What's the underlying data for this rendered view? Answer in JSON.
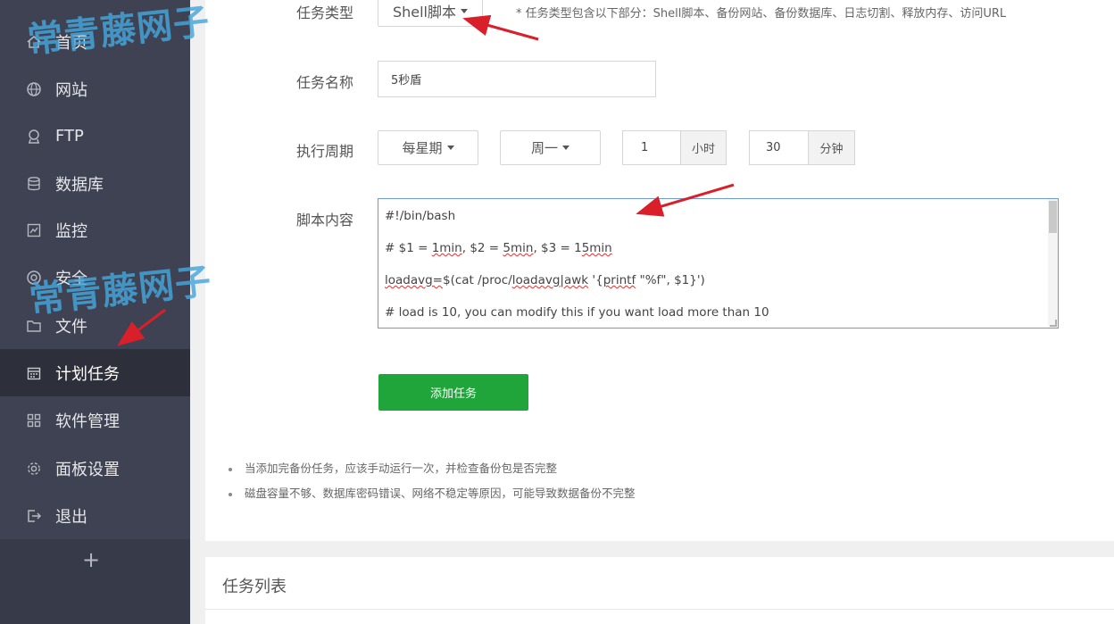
{
  "sidebar": {
    "items": [
      {
        "label": "首页",
        "icon": "home-icon"
      },
      {
        "label": "网站",
        "icon": "globe-icon"
      },
      {
        "label": "FTP",
        "icon": "ftp-icon"
      },
      {
        "label": "数据库",
        "icon": "database-icon"
      },
      {
        "label": "监控",
        "icon": "monitor-icon"
      },
      {
        "label": "安全",
        "icon": "shield-icon"
      },
      {
        "label": "文件",
        "icon": "folder-icon"
      },
      {
        "label": "计划任务",
        "icon": "calendar-icon"
      },
      {
        "label": "软件管理",
        "icon": "apps-icon"
      },
      {
        "label": "面板设置",
        "icon": "gear-icon"
      },
      {
        "label": "退出",
        "icon": "logout-icon"
      }
    ],
    "active": "计划任务",
    "add_symbol": "+"
  },
  "form": {
    "task_type": {
      "label": "任务类型",
      "value": "Shell脚本",
      "note": "*  任务类型包含以下部分：Shell脚本、备份网站、备份数据库、日志切割、释放内存、访问URL"
    },
    "task_name": {
      "label": "任务名称",
      "value": "5秒盾"
    },
    "schedule": {
      "label": "执行周期",
      "period": "每星期",
      "day": "周一",
      "hour": "1",
      "hour_unit": "小时",
      "minute": "30",
      "minute_unit": "分钟"
    },
    "script": {
      "label": "脚本内容",
      "lines": [
        "#!/bin/bash",
        "# $1 = 1min, $2 = 5min, $3 = 15min",
        "loadavg=$(cat /proc/loadavg|awk '{printf \"%f\", $1}')",
        "# load is 10, you can modify this if you want load more than 10"
      ]
    },
    "submit_label": "添加任务"
  },
  "tips": [
    "当添加完备份任务，应该手动运行一次，并检查备份包是否完整",
    "磁盘容量不够、数据库密码错误、网络不稳定等原因，可能导致数据备份不完整"
  ],
  "task_list": {
    "title": "任务列表"
  },
  "watermark": "常青藤网子",
  "colors": {
    "sidebar": "#3e4252",
    "sidebar_active": "#2d303b",
    "primary": "#20a53a",
    "watermark": "#46a6dc",
    "arrow": "#d9202a"
  }
}
